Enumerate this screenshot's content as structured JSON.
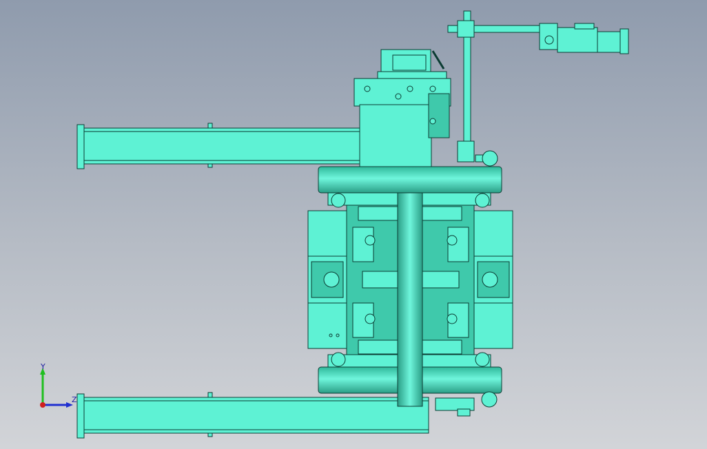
{
  "viewport": {
    "background_top": "#8f9bad",
    "background_bottom": "#d2d4d8"
  },
  "model": {
    "body_color": "#5ef2d4",
    "shade_color": "#3fc9ab",
    "dark_shade_color": "#2a9e86",
    "edge_color": "#0b3b32"
  },
  "triad": {
    "y_label": "Y",
    "z_label": "Z",
    "y_color": "#1fbf1f",
    "z_color": "#1f2fd0",
    "x_color": "#d01f1f"
  }
}
